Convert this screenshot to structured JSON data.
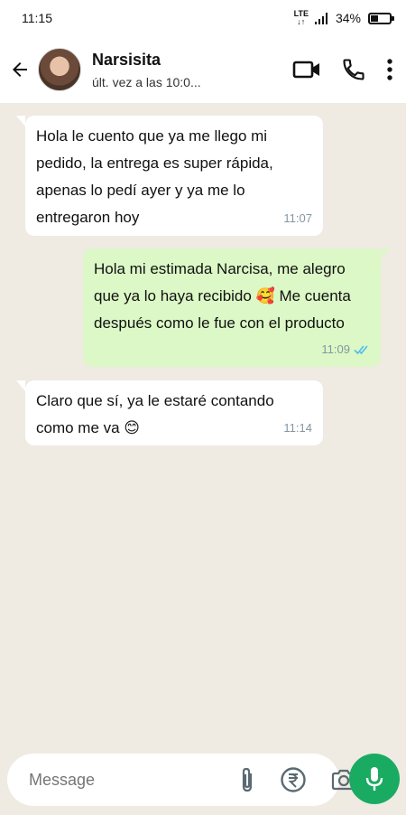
{
  "status_bar": {
    "time": "11:15",
    "network": "LTE",
    "battery": "34%"
  },
  "header": {
    "contact_name": "Narsisita",
    "contact_status": "últ. vez a las 10:0..."
  },
  "messages": [
    {
      "direction": "in",
      "text": "Hola le cuento que ya me llego mi pedido, la entrega es super rápida, apenas lo pedí ayer y ya me lo entregaron hoy",
      "time": "11:07"
    },
    {
      "direction": "out",
      "text": "Hola mi estimada Narcisa, me alegro que ya lo haya recibido 🥰 Me cuenta después como le fue con el producto",
      "time": "11:09",
      "status": "read"
    },
    {
      "direction": "in",
      "text": "Claro que sí, ya le estaré contando como me va 😊",
      "time": "11:14"
    }
  ],
  "composer": {
    "placeholder": "Message"
  },
  "colors": {
    "chat_background": "#efeae2",
    "outgoing_bubble": "#dcf8c6",
    "incoming_bubble": "#ffffff",
    "mic_button": "#1aab62",
    "read_ticks": "#53bdeb"
  },
  "icons": [
    "back-arrow-icon",
    "video-call-icon",
    "phone-icon",
    "more-vert-icon",
    "sticker-icon",
    "attach-icon",
    "rupee-payment-icon",
    "camera-icon",
    "mic-icon",
    "double-check-icon"
  ]
}
